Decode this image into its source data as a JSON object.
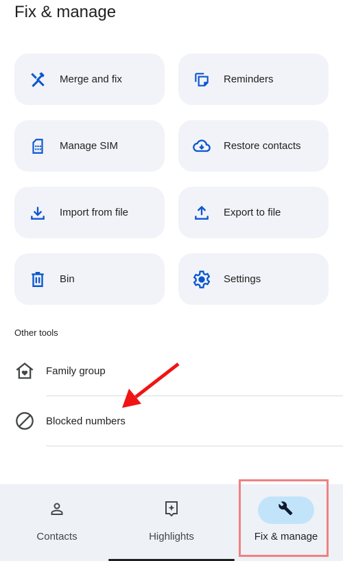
{
  "header": {
    "title": "Fix & manage"
  },
  "colors": {
    "accent": "#0b57d0",
    "card_bg": "#f2f3f8",
    "nav_bg": "#eef1f6",
    "active_pill": "#c2e4fb",
    "annotation": "#f01414"
  },
  "tools": [
    {
      "label": "Merge and fix",
      "icon": "merge-fix-icon"
    },
    {
      "label": "Reminders",
      "icon": "reminders-icon"
    },
    {
      "label": "Manage SIM",
      "icon": "sim-card-icon"
    },
    {
      "label": "Restore contacts",
      "icon": "cloud-download-icon"
    },
    {
      "label": "Import from file",
      "icon": "download-icon"
    },
    {
      "label": "Export to file",
      "icon": "upload-icon"
    },
    {
      "label": "Bin",
      "icon": "trash-icon"
    },
    {
      "label": "Settings",
      "icon": "gear-icon"
    }
  ],
  "other_tools": {
    "label": "Other tools",
    "items": [
      {
        "label": "Family group",
        "icon": "family-home-icon"
      },
      {
        "label": "Blocked numbers",
        "icon": "block-icon"
      }
    ]
  },
  "nav": {
    "items": [
      {
        "label": "Contacts",
        "icon": "person-icon",
        "active": false
      },
      {
        "label": "Highlights",
        "icon": "highlights-icon",
        "active": false
      },
      {
        "label": "Fix & manage",
        "icon": "wrench-icon",
        "active": true
      }
    ]
  }
}
